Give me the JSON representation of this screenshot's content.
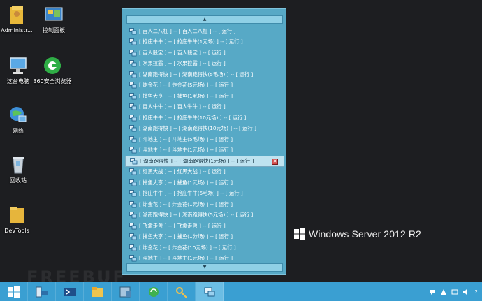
{
  "desktop": {
    "icons": [
      {
        "label": "Administr..."
      },
      {
        "label": "控制面板"
      },
      {
        "label": "这台电脑"
      },
      {
        "label": "360安全浏览器"
      },
      {
        "label": "网络"
      },
      {
        "label": "回收站"
      },
      {
        "label": "DevTools"
      }
    ],
    "brand": "Windows Server 2012 R2",
    "watermark": "FREEBUF"
  },
  "panel": {
    "scroll_up": "▲",
    "scroll_down": "▼",
    "items": [
      "[ 百人二八杠 ] -- [ 百人二八杠 ] -- [ 运行 ]",
      "[ 抢庄牛牛 ] -- [ 抢庄牛牛(1元场) ] -- [ 运行 ]",
      "[ 百人骰宝 ] -- [ 百人骰宝 ] -- [ 运行 ]",
      "[ 水果拉霸 ] -- [ 水果拉霸 ] -- [ 运行 ]",
      "[ 湖南跑得快 ] -- [ 湖南跑得快(5毛场) ] -- [ 运行 ]",
      "[ 炸金花 ] -- [ 炸金花(5元场) ] -- [ 运行 ]",
      "[ 捕鱼大亨 ] -- [ 捕鱼(1毛场) ] -- [ 运行 ]",
      "[ 百人牛牛 ] -- [ 百人牛牛 ] -- [ 运行 ]",
      "[ 抢庄牛牛 ] -- [ 抢庄牛牛(10元场) ] -- [ 运行 ]",
      "[ 湖南跑得快 ] -- [ 湖南跑得快(10元场) ] -- [ 运行 ]",
      "[ 斗地主 ] -- [ 斗地主(5毛场) ] -- [ 运行 ]",
      "[ 斗地主 ] -- [ 斗地主(1元场) ] -- [ 运行 ]",
      "[ 湖南跑得快 ] -- [ 湖南跑得快(1元场) ] -- [ 运行 ]",
      "[ 红黑大战 ] -- [ 红黑大战 ] -- [ 运行 ]",
      "[ 捕鱼大亨 ] -- [ 捕鱼(1元场) ] -- [ 运行 ]",
      "[ 抢庄牛牛 ] -- [ 抢庄牛牛(5毛场) ] -- [ 运行 ]",
      "[ 炸金花 ] -- [ 炸金花(1元场) ] -- [ 运行 ]",
      "[ 湖南跑得快 ] -- [ 湖南跑得快(5元场) ] -- [ 运行 ]",
      "[ 飞禽走兽 ] -- [ 飞禽走兽 ] -- [ 运行 ]",
      "[ 捕鱼大亨 ] -- [ 捕鱼(1分场) ] -- [ 运行 ]",
      "[ 炸金花 ] -- [ 炸金花(10元场) ] -- [ 运行 ]",
      "[ 斗地主 ] -- [ 斗地主(1元场) ] -- [ 运行 ]"
    ],
    "selected_index": 12,
    "close_glyph": "✕"
  },
  "taskbar": {
    "clock": "2"
  }
}
